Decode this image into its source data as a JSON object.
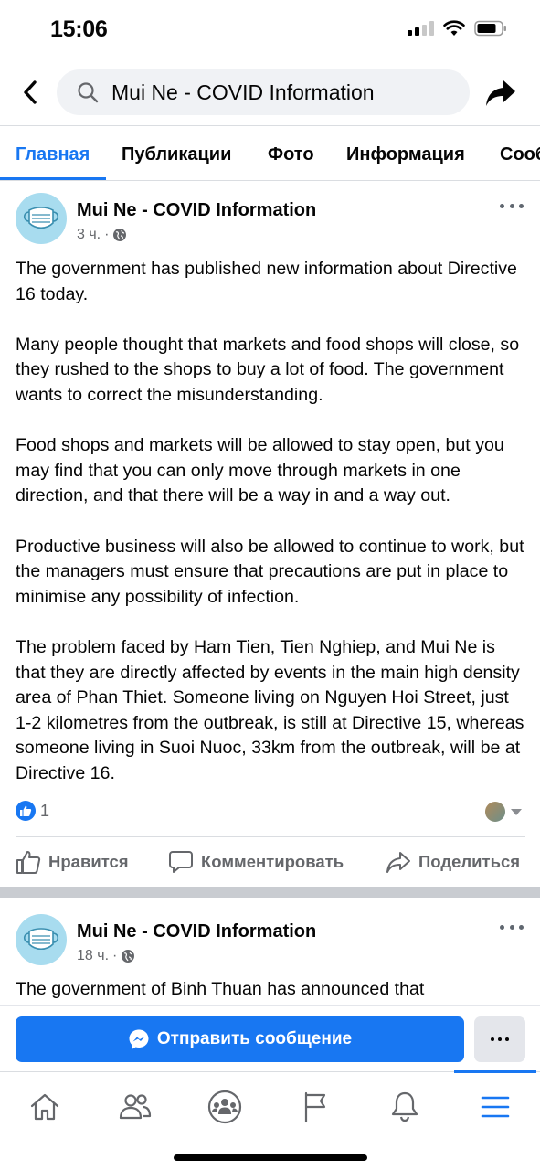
{
  "status_bar": {
    "time": "15:06",
    "icons": [
      "cellular-signal-icon",
      "wifi-icon",
      "battery-icon"
    ]
  },
  "header": {
    "back_icon": "chevron-left-icon",
    "search_icon": "search-icon",
    "search_text": "Mui Ne - COVID Information",
    "share_icon": "share-arrow-icon"
  },
  "tabs": [
    {
      "label": "Главная",
      "active": true
    },
    {
      "label": "Публикации",
      "active": false
    },
    {
      "label": "Фото",
      "active": false
    },
    {
      "label": "Информация",
      "active": false
    },
    {
      "label": "Сооб",
      "active": false
    }
  ],
  "posts": [
    {
      "author": "Mui Ne - COVID Information",
      "time": "3 ч.",
      "audience_icon": "globe-icon",
      "paragraphs": [
        "The government has published new information about Directive 16 today.",
        "Many people thought that markets and food shops will close, so they rushed to the shops to buy a lot of food. The government wants to correct the misunderstanding.",
        "Food shops and markets will be allowed to stay open, but you may find that you can only move through markets in one direction, and that there will be a way in and a way out.",
        "Productive business will also be allowed to continue to work, but the managers must ensure that precautions are put in place to minimise any possibility of infection.",
        "The problem faced by Ham Tien, Tien Nghiep, and Mui Ne is that they are directly affected by events in the main high density area of Phan Thiet.   Someone living on Nguyen Hoi Street, just 1-2 kilometres from the outbreak, is still at Directive 15, whereas someone living in Suoi Nuoc, 33km from the outbreak, will be at Directive 16."
      ],
      "like_count": "1",
      "actions": {
        "like": "Нравится",
        "comment": "Комментировать",
        "share": "Поделиться"
      }
    },
    {
      "author": "Mui Ne - COVID Information",
      "time": "18 ч.",
      "audience_icon": "globe-icon",
      "text_preview": "The government of Binh Thuan has announced that"
    }
  ],
  "message_bar": {
    "send_label": "Отправить сообщение",
    "messenger_icon": "messenger-icon",
    "more_icon": "more-dots-icon"
  },
  "bottom_nav": {
    "items": [
      "home-icon",
      "friends-icon",
      "groups-icon",
      "pages-flag-icon",
      "notifications-bell-icon",
      "menu-icon"
    ],
    "active": "menu-icon"
  },
  "colors": {
    "brand": "#1877f2",
    "secondary_text": "#65676b",
    "avatar_bg": "#a8dcef",
    "search_bg": "#f0f2f5"
  }
}
